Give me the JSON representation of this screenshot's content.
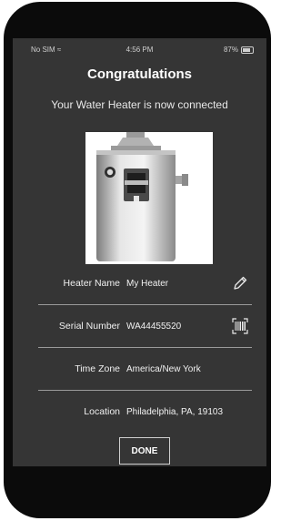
{
  "status_bar": {
    "carrier": "No SIM",
    "time": "4:56 PM",
    "battery": "87%"
  },
  "header": {
    "title": "Congratulations",
    "subtitle": "Your Water Heater is now connected"
  },
  "details": [
    {
      "label": "Heater Name",
      "value": "My Heater",
      "icon": "pencil-icon"
    },
    {
      "label": "Serial Number",
      "value": "WA44455520",
      "icon": "barcode-scan-icon"
    },
    {
      "label": "Time Zone",
      "value": "America/New York"
    },
    {
      "label": "Location",
      "value": "Philadelphia, PA, 19103"
    }
  ],
  "done_label": "DONE"
}
